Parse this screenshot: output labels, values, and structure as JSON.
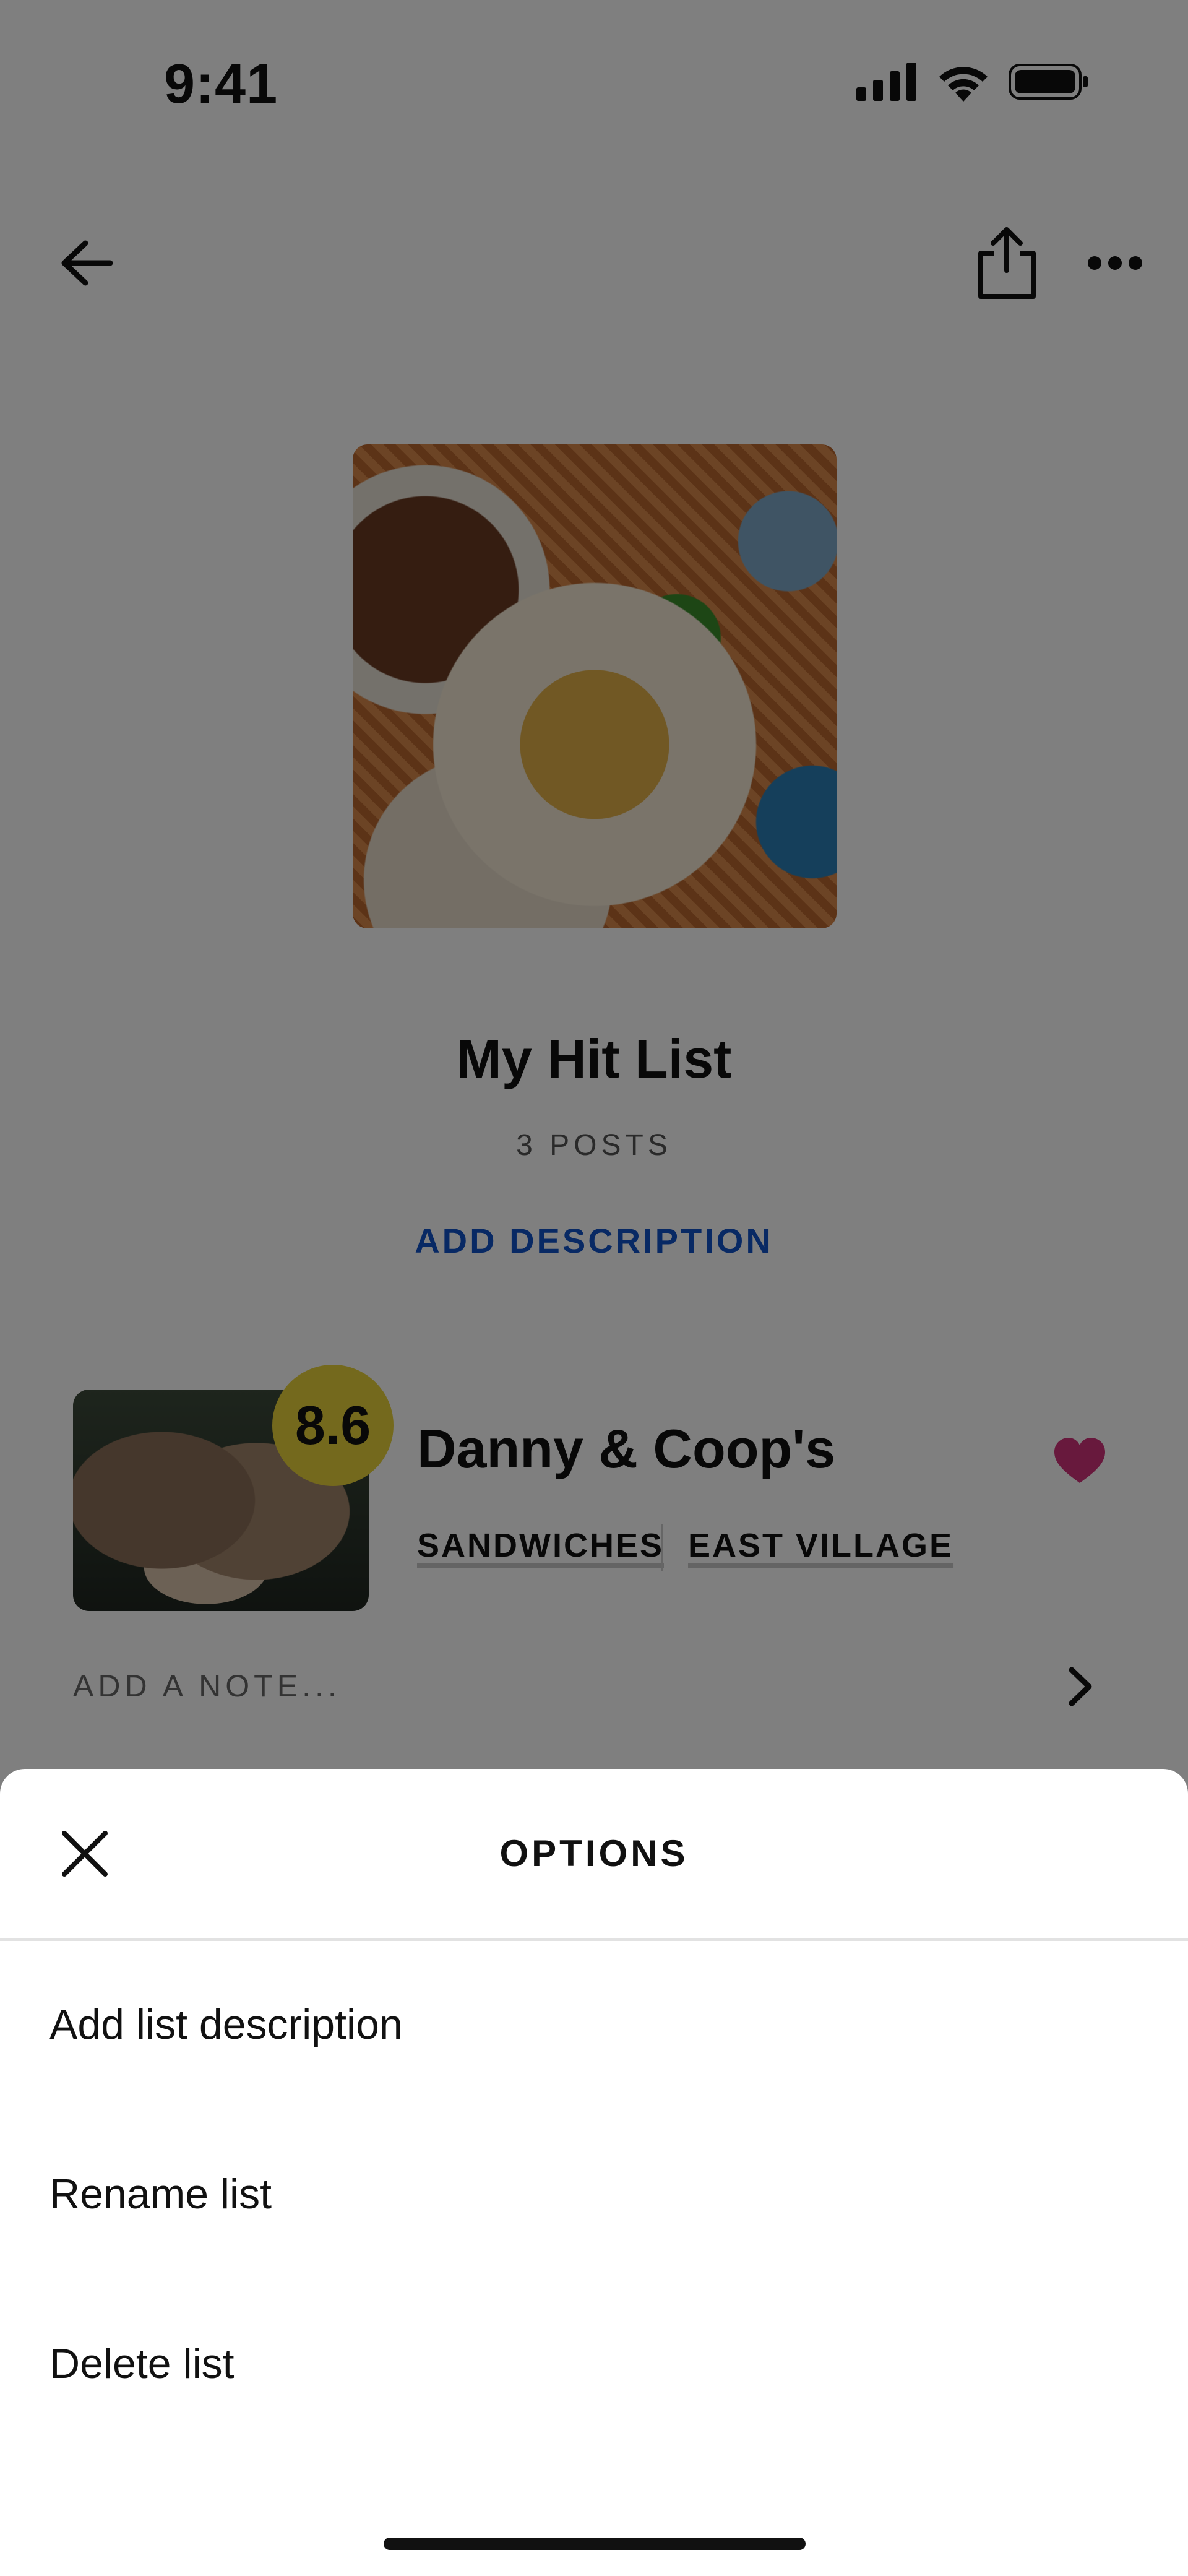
{
  "status_bar": {
    "time": "9:41"
  },
  "header": {
    "back_icon": "arrow-left-icon",
    "share_icon": "share-icon",
    "more_icon": "more-horizontal-icon"
  },
  "list": {
    "title": "My Hit List",
    "post_count": "3 POSTS",
    "add_description": "ADD DESCRIPTION"
  },
  "items": [
    {
      "score": "8.6",
      "name": "Danny & Coop's",
      "tags": [
        "SANDWICHES",
        "EAST VILLAGE"
      ],
      "note_placeholder": "ADD A NOTE...",
      "favorited": true
    }
  ],
  "options_sheet": {
    "title": "OPTIONS",
    "options": [
      {
        "label": "Add list description"
      },
      {
        "label": "Rename list"
      },
      {
        "label": "Delete list"
      }
    ]
  },
  "colors": {
    "accent_link": "#1152c8",
    "score_badge": "#e8d23a",
    "heart": "#d1337a",
    "overlay": "rgba(0,0,0,0.5)"
  }
}
